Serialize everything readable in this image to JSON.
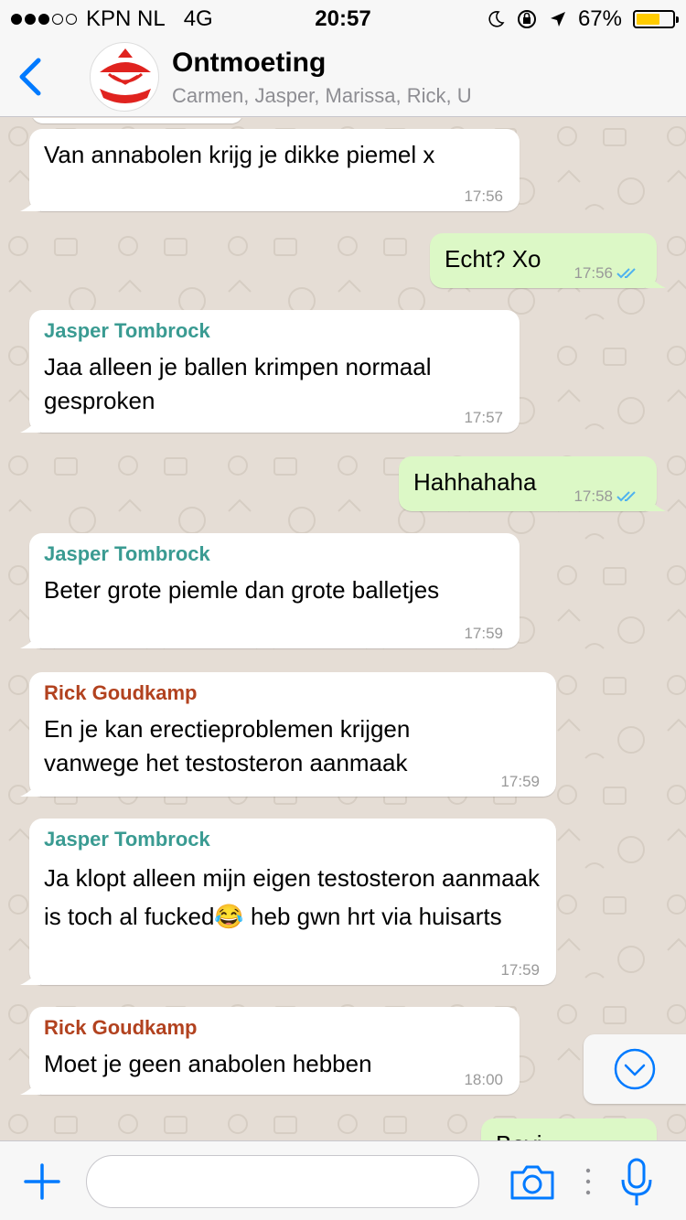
{
  "status_bar": {
    "carrier": "KPN NL",
    "network": "4G",
    "time": "20:57",
    "battery": "67%",
    "battery_level": 0.67,
    "signal_bars": 3
  },
  "header": {
    "title": "Ontmoeting",
    "participants": "Carmen, Jasper, Marissa, Rick, U"
  },
  "colors": {
    "accent": "#007aff",
    "jasper": "#3a9b92",
    "rick": "#b2421f",
    "outgoing": "#dcf8c6",
    "ticks": "#4fb2ef"
  },
  "messages": [
    {
      "direction": "in",
      "sender": "",
      "text": "Van annabolen krijg je dikke piemel x",
      "time": "17:56"
    },
    {
      "direction": "out",
      "sender": "",
      "text": "Echt? Xo",
      "time": "17:56"
    },
    {
      "direction": "in",
      "sender": "Jasper Tombrock",
      "text": "Jaa alleen je ballen krimpen normaal gesproken",
      "time": "17:57"
    },
    {
      "direction": "out",
      "sender": "",
      "text": "Hahhahaha",
      "time": "17:58"
    },
    {
      "direction": "in",
      "sender": "Jasper Tombrock",
      "text": "Beter grote piemle dan grote balletjes",
      "time": "17:59"
    },
    {
      "direction": "in",
      "sender": "Rick Goudkamp",
      "text": "En je kan erectieproblemen krijgen vanwege het testosteron aanmaak",
      "time": "17:59"
    },
    {
      "direction": "in",
      "sender": "Jasper Tombrock",
      "text": "Ja klopt alleen mijn eigen testosteron aanmaak is toch al fucked😂 heb gwn hrt via huisarts",
      "time": "17:59"
    },
    {
      "direction": "in",
      "sender": "Rick Goudkamp",
      "text": "Moet je geen anabolen hebben",
      "time": "18:00"
    },
    {
      "direction": "out",
      "sender": "",
      "text": "Bevi",
      "time": ""
    }
  ],
  "input": {
    "placeholder": ""
  },
  "icons": {
    "back": "chevron-left-icon",
    "plus": "plus-icon",
    "camera": "camera-icon",
    "mic": "microphone-icon",
    "scroll": "chevron-down-circle-icon"
  }
}
